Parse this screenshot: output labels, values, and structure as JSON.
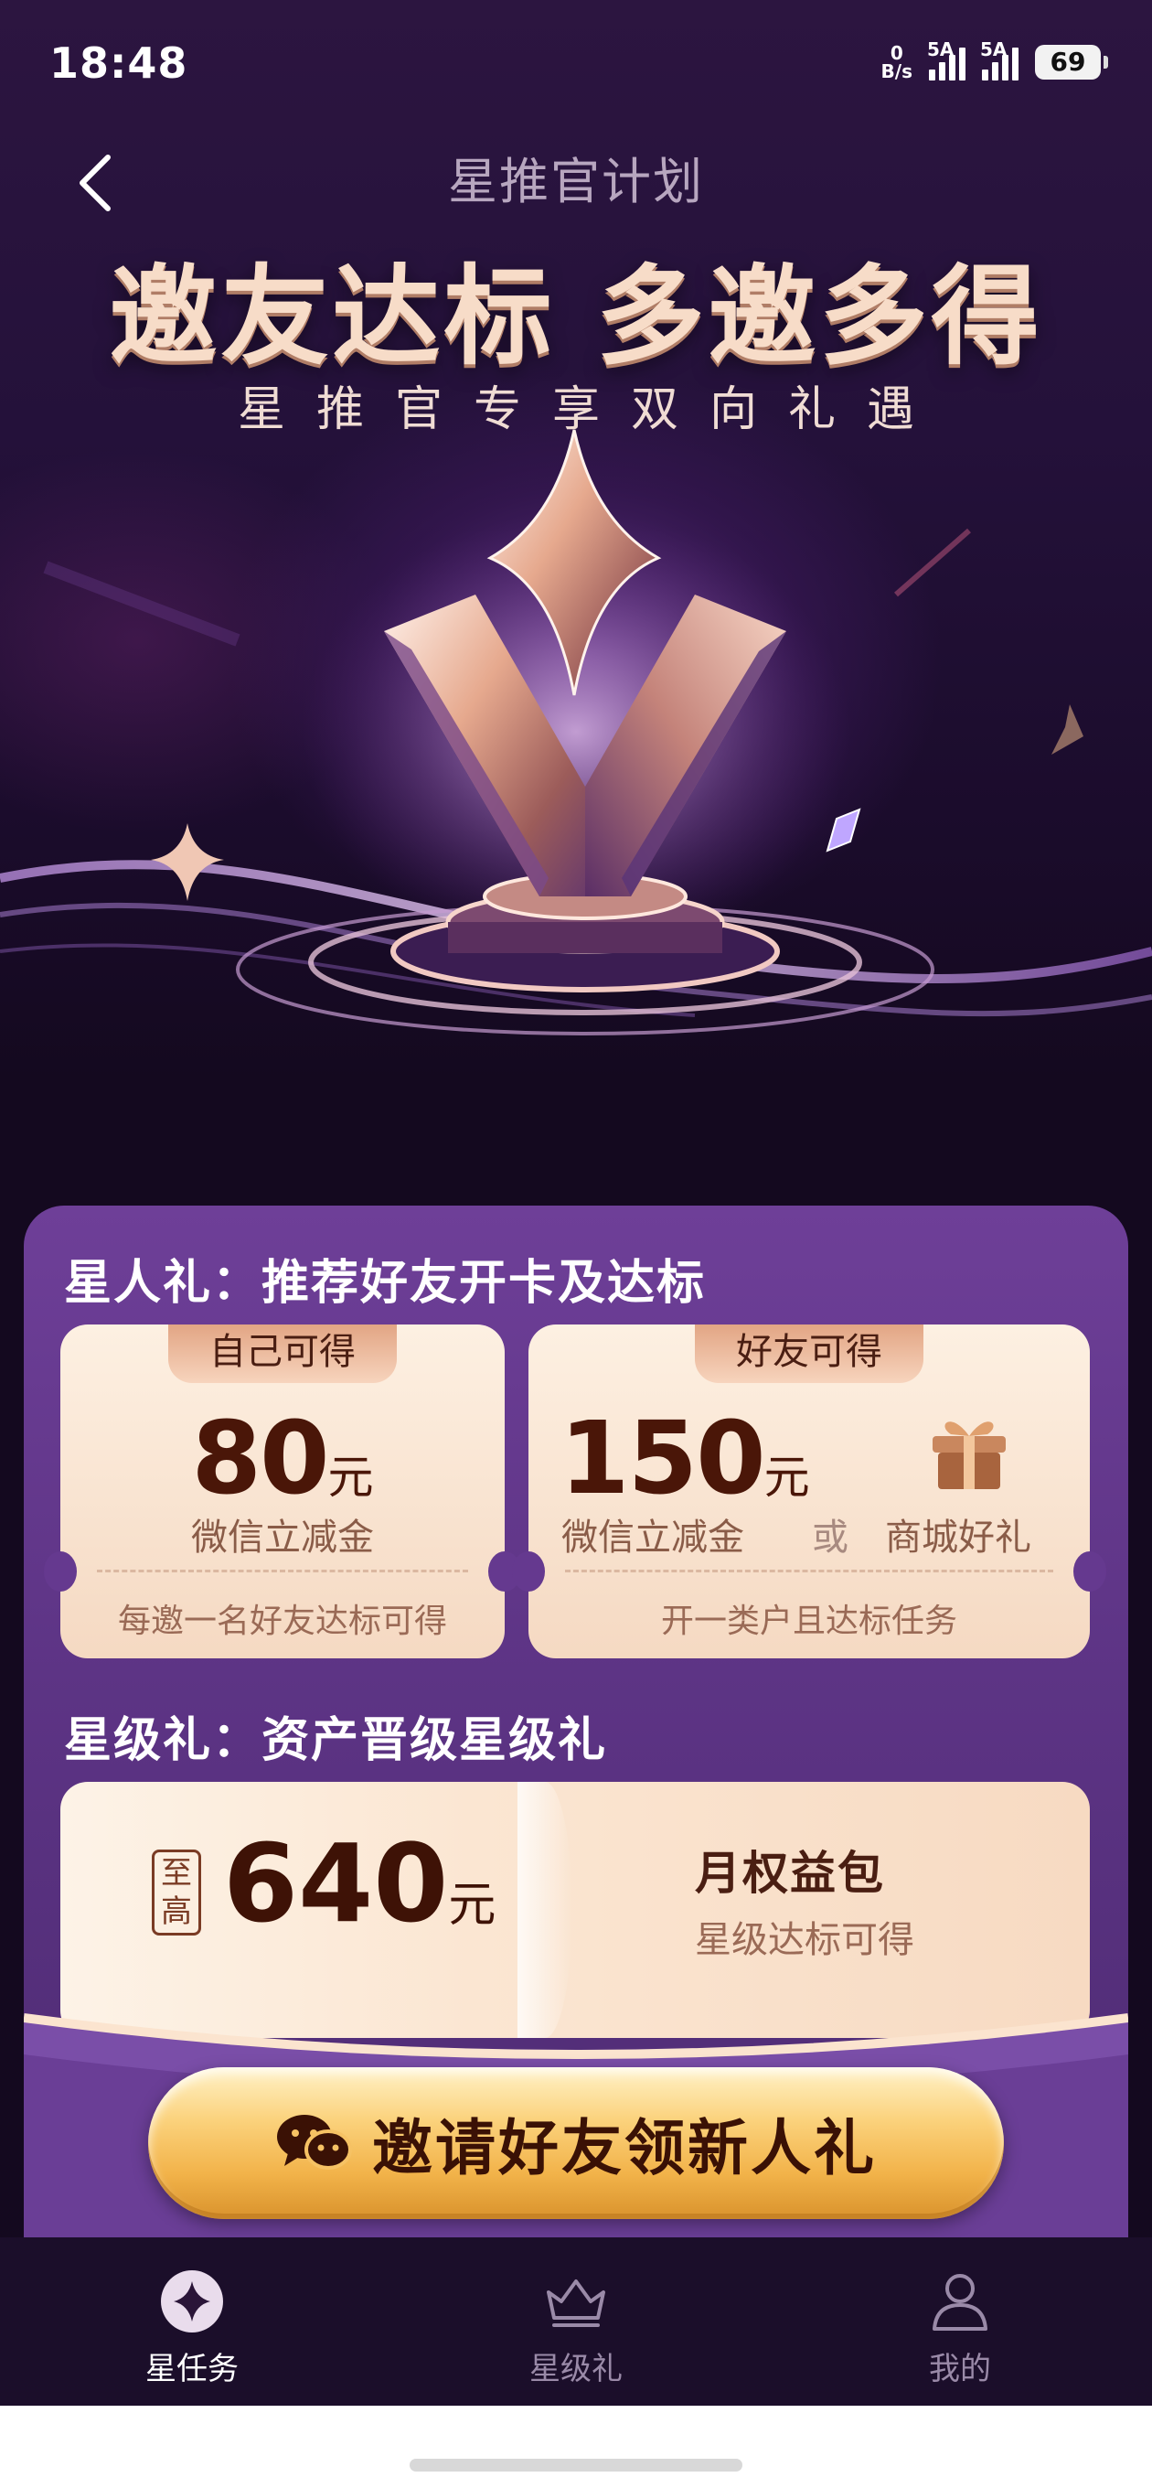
{
  "status_bar": {
    "time": "18:48",
    "net_speed_value": "0",
    "net_speed_unit": "B/s",
    "signal1_tag": "5A",
    "signal2_tag": "5A",
    "battery": "69"
  },
  "header": {
    "title": "星推官计划"
  },
  "hero": {
    "title": "邀友达标 多邀多得",
    "subtitle": "星推官专享双向礼遇"
  },
  "star_gift": {
    "title": "星人礼：推荐好友开卡及达标",
    "self_card": {
      "tab": "自己可得",
      "amount": "80",
      "unit": "元",
      "label": "微信立减金",
      "footer": "每邀一名好友达标可得"
    },
    "friend_card": {
      "tab": "好友可得",
      "amount": "150",
      "unit": "元",
      "label": "微信立减金",
      "or": "或",
      "gift_label": "商城好礼",
      "footer": "开一类户且达标任务"
    }
  },
  "level_gift": {
    "title": "星级礼：资产晋级星级礼",
    "max_prefix_1": "至",
    "max_prefix_2": "高",
    "amount": "640",
    "unit": "元",
    "benefit_title": "月权益包",
    "benefit_sub": "星级达标可得"
  },
  "invite_button": {
    "label": "邀请好友领新人礼"
  },
  "tab_bar": {
    "tabs": [
      {
        "label": "星任务",
        "icon": "star-badge-icon",
        "active": true
      },
      {
        "label": "星级礼",
        "icon": "crown-icon",
        "active": false
      },
      {
        "label": "我的",
        "icon": "person-icon",
        "active": false
      }
    ]
  },
  "colors": {
    "panel_purple": "#6e3f98",
    "card_cream": "#fdf0e2",
    "amount_brown": "#4a1608",
    "button_gold": "#fbd27c"
  }
}
